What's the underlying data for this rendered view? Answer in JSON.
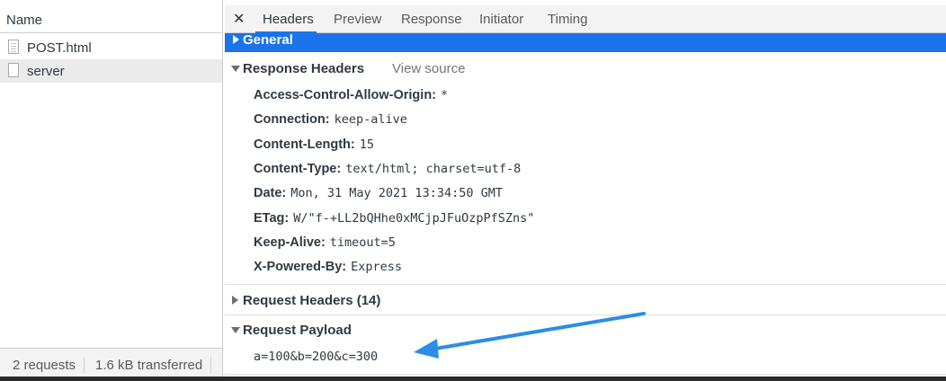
{
  "network": {
    "column_header": "Name",
    "requests": [
      {
        "name": "POST.html"
      },
      {
        "name": "server"
      }
    ],
    "status": {
      "requests": "2 requests",
      "transferred": "1.6 kB transferred"
    }
  },
  "details": {
    "close_glyph": "✕",
    "tabs": [
      "Headers",
      "Preview",
      "Response",
      "Initiator",
      "Timing"
    ],
    "active_tab": "Headers",
    "general_label": "General",
    "response_headers_label": "Response Headers",
    "view_source_label": "View source",
    "response_headers": [
      {
        "key": "Access-Control-Allow-Origin:",
        "value": "*"
      },
      {
        "key": "Connection:",
        "value": "keep-alive"
      },
      {
        "key": "Content-Length:",
        "value": "15"
      },
      {
        "key": "Content-Type:",
        "value": "text/html; charset=utf-8"
      },
      {
        "key": "Date:",
        "value": "Mon, 31 May 2021 13:34:50 GMT"
      },
      {
        "key": "ETag:",
        "value": "W/\"f-+LL2bQHhe0xMCjpJFuOzpPfSZns\""
      },
      {
        "key": "Keep-Alive:",
        "value": "timeout=5"
      },
      {
        "key": "X-Powered-By:",
        "value": "Express"
      }
    ],
    "request_headers_label": "Request Headers (14)",
    "request_payload_label": "Request Payload",
    "payload_text": "a=100&b=200&c=300"
  },
  "colors": {
    "accent": "#1a73e8",
    "annotation_arrow": "#2b8ee6"
  }
}
